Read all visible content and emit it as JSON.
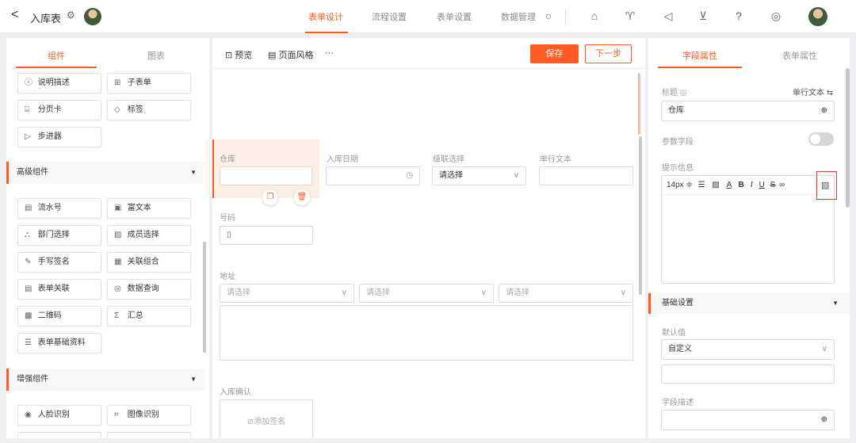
{
  "header": {
    "back_glyph": "<",
    "title": "入库表",
    "tabs": [
      {
        "label": "表单设计",
        "active": true
      },
      {
        "label": "流程设置"
      },
      {
        "label": "表单设置"
      },
      {
        "label": "数据管理"
      }
    ],
    "icons": [
      "search-icon",
      "home-icon",
      "shirt-icon",
      "megaphone-icon",
      "download-icon",
      "help-icon",
      "settings-icon"
    ]
  },
  "left": {
    "tabs": [
      "组件",
      "图表"
    ],
    "basic_items": [
      {
        "label": "说明描述",
        "icon": "ⓘ"
      },
      {
        "label": "子表单",
        "icon": "⊞"
      },
      {
        "label": "分页卡",
        "icon": "⌸"
      },
      {
        "label": "标签",
        "icon": "◇"
      },
      {
        "label": "步进器",
        "icon": "▷"
      }
    ],
    "advanced_title": "高级组件",
    "advanced_items": [
      {
        "label": "流水号",
        "icon": "▤"
      },
      {
        "label": "富文本",
        "icon": "▣"
      },
      {
        "label": "部门选择",
        "icon": "⛬"
      },
      {
        "label": "成员选择",
        "icon": "▨"
      },
      {
        "label": "手写签名",
        "icon": "✎"
      },
      {
        "label": "关联组合",
        "icon": "▦"
      },
      {
        "label": "表单关联",
        "icon": "▤"
      },
      {
        "label": "数据查询",
        "icon": "◎"
      },
      {
        "label": "二维码",
        "icon": "▩"
      },
      {
        "label": "汇总",
        "icon": "Σ"
      },
      {
        "label": "表单基础资料",
        "icon": "☰"
      }
    ],
    "enhanced_title": "增强组件",
    "enhanced_items": [
      {
        "label": "人脸识别",
        "icon": "◉"
      },
      {
        "label": "图像识别",
        "icon": "⌗"
      }
    ]
  },
  "canvas": {
    "preview": "预览",
    "style": "页面风格",
    "more": "···",
    "save": "保存",
    "next": "下一步",
    "fields": {
      "warehouse": "仓库",
      "date": "入库日期",
      "cascade": "级联选择",
      "cascade_ph": "请选择",
      "text": "单行文本",
      "code": "号码",
      "address": "地址",
      "addr_ph": "请选择",
      "confirm": "入库确认",
      "sign": "⊘添加签名"
    }
  },
  "right": {
    "tabs": [
      "字段属性",
      "表单属性"
    ],
    "title_label": "标题",
    "type_label": "单行文本",
    "title_value": "仓库",
    "param_label": "参数字段",
    "hint_label": "提示信息",
    "font_size": "14px ≑",
    "basic_section": "基础设置",
    "default_label": "默认值",
    "default_value": "自定义",
    "desc_label": "字段描述"
  },
  "colors": {
    "accent": "#ff5b22",
    "highlight_box": "#e53935"
  }
}
